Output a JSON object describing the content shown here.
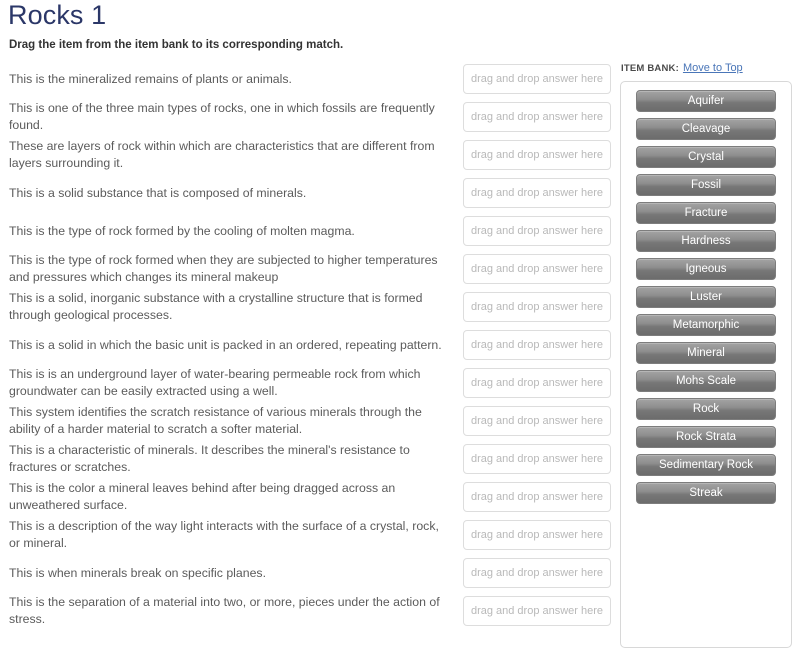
{
  "header": {
    "title": "Rocks 1",
    "instructions": "Drag the item from the item bank to its corresponding match."
  },
  "dropzone_placeholder": "drag and drop answer here",
  "match_rows": [
    {
      "prompt": "This is the mineralized remains of plants or animals.",
      "answer": ""
    },
    {
      "prompt": "This is one of the three main types of rocks, one in which fossils are frequently found.",
      "answer": ""
    },
    {
      "prompt": "These are layers of rock within which are characteristics that are different from layers surrounding it.",
      "answer": ""
    },
    {
      "prompt": "This is a solid substance that is composed of minerals.",
      "answer": ""
    },
    {
      "prompt": "This is the type of rock formed by the cooling of molten magma.",
      "answer": ""
    },
    {
      "prompt": "This is the type of rock formed when they are subjected to higher temperatures and pressures which changes its mineral makeup",
      "answer": ""
    },
    {
      "prompt": "This is a solid, inorganic substance with a crystalline structure that is formed through geological processes.",
      "answer": ""
    },
    {
      "prompt": "This is a solid in which the basic unit is packed in an ordered, repeating pattern.",
      "answer": ""
    },
    {
      "prompt": "This is is an underground layer of water-bearing permeable rock from which groundwater can be easily extracted using a well.",
      "answer": ""
    },
    {
      "prompt": "This system identifies the scratch resistance of various minerals through the ability of a harder material to scratch a softer material.",
      "answer": ""
    },
    {
      "prompt": "This is a characteristic of minerals. It describes the mineral's resistance to fractures or scratches.",
      "answer": ""
    },
    {
      "prompt": "This is the color a mineral leaves behind after being dragged across an unweathered surface.",
      "answer": ""
    },
    {
      "prompt": "This is a description of the way light interacts with the surface of a crystal, rock, or mineral.",
      "answer": ""
    },
    {
      "prompt": "This is when minerals break on specific planes.",
      "answer": ""
    },
    {
      "prompt": "This is the separation of a material into two, or more, pieces under the action of stress.",
      "answer": ""
    }
  ],
  "item_bank": {
    "label": "ITEM BANK:",
    "move_to_top_link": "Move to Top",
    "items": [
      "Aquifer",
      "Cleavage",
      "Crystal",
      "Fossil",
      "Fracture",
      "Hardness",
      "Igneous",
      "Luster",
      "Metamorphic",
      "Mineral",
      "Mohs Scale",
      "Rock",
      "Rock Strata",
      "Sedimentary Rock",
      "Streak"
    ]
  },
  "colors": {
    "title": "#2b3768",
    "prompt_text": "#5b5b5b",
    "link": "#4a76b8",
    "item_bank_button": "#8e8e8e",
    "dropzone_border": "#dddddd",
    "placeholder_text": "#b9b9b9"
  }
}
